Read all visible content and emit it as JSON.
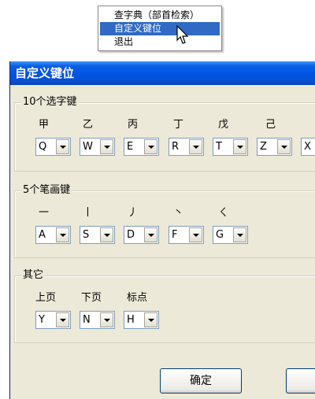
{
  "context_menu": {
    "items": [
      {
        "label": "查字典（部首检索）"
      },
      {
        "label": "自定义键位"
      },
      {
        "label": "退出"
      }
    ]
  },
  "dialog": {
    "title": "自定义键位",
    "groups": {
      "select_keys": {
        "title": "10个选字键",
        "columns": [
          {
            "label": "甲",
            "value": "Q"
          },
          {
            "label": "乙",
            "value": "W"
          },
          {
            "label": "丙",
            "value": "E"
          },
          {
            "label": "丁",
            "value": "R"
          },
          {
            "label": "戊",
            "value": "T"
          },
          {
            "label": "己",
            "value": "Z"
          },
          {
            "label": "",
            "value": "X"
          }
        ]
      },
      "stroke_keys": {
        "title": "5个笔画键",
        "columns": [
          {
            "label": "一",
            "value": "A"
          },
          {
            "label": "丨",
            "value": "S"
          },
          {
            "label": "丿",
            "value": "D"
          },
          {
            "label": "丶",
            "value": "F"
          },
          {
            "label": "ㄑ",
            "value": "G"
          }
        ]
      },
      "other_keys": {
        "title": "其它",
        "columns": [
          {
            "label": "上页",
            "value": "Y"
          },
          {
            "label": "下页",
            "value": "N"
          },
          {
            "label": "标点",
            "value": "H"
          }
        ]
      }
    },
    "ok_label": "确定"
  }
}
